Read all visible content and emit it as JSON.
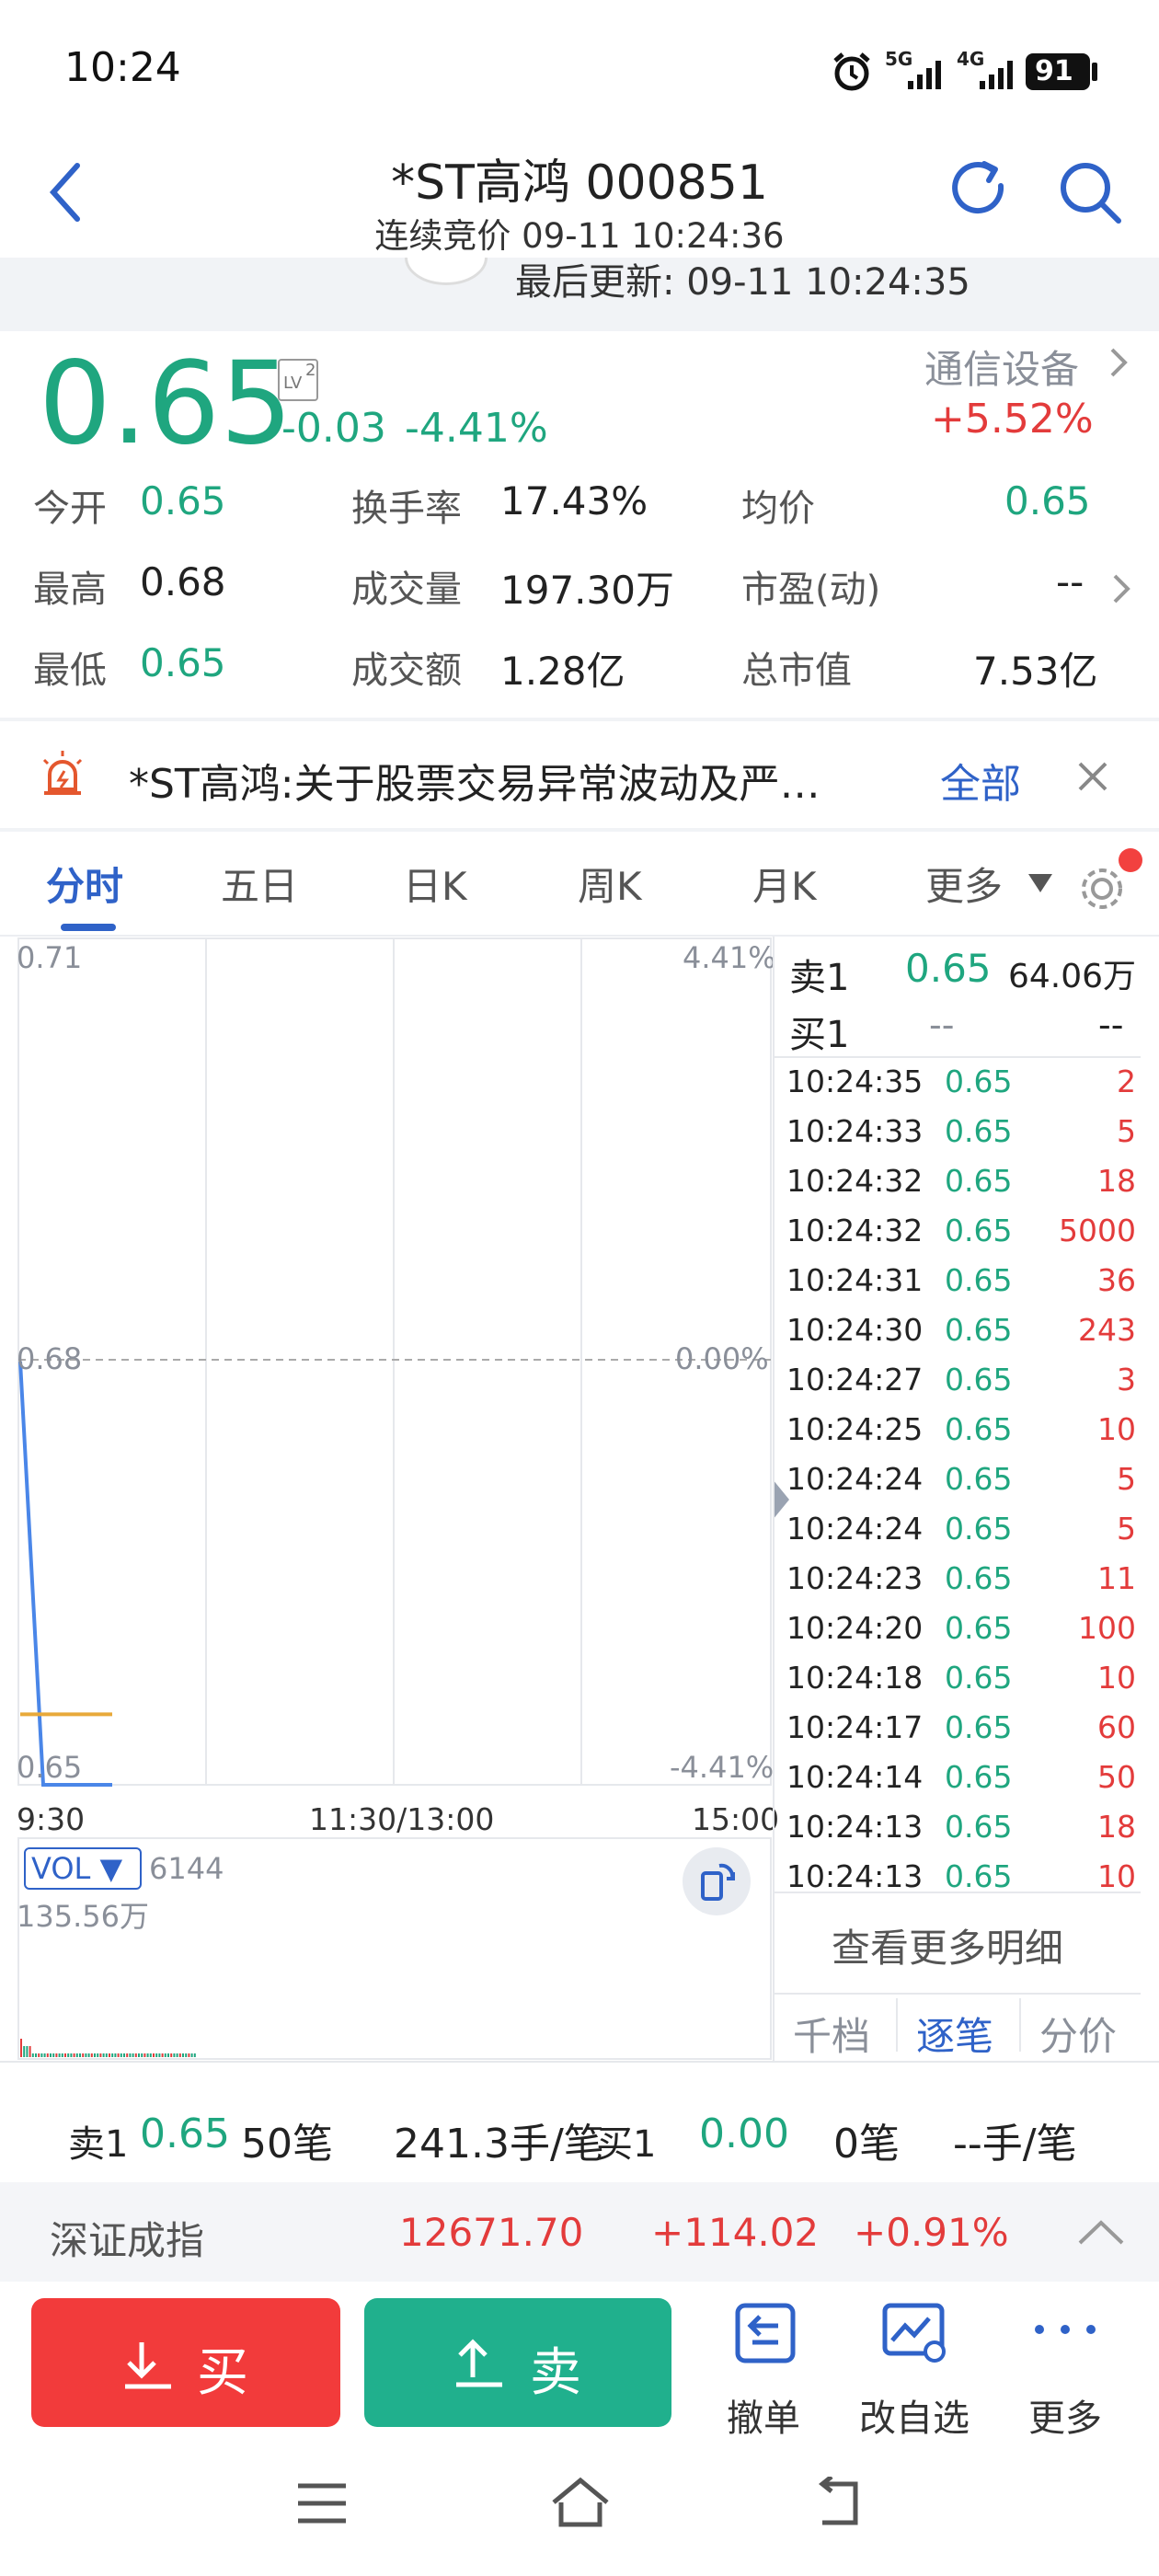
{
  "status_bar": {
    "time": "10:24",
    "net1": "5G",
    "net2": "4G",
    "battery": "91"
  },
  "header": {
    "title": "*ST高鸿 000851",
    "subtitle": "连续竞价 09-11 10:24:36"
  },
  "strip": {
    "text": "最后更新: 09-11 10:24:35"
  },
  "quote": {
    "price": "0.65",
    "level_badge": "LV",
    "level_sup": "2",
    "change": "-0.03",
    "change_pct": "-4.41%",
    "sector_name": "通信设备",
    "sector_change": "+5.52%",
    "stats": [
      {
        "label": "今开",
        "value": "0.65"
      },
      {
        "label": "换手率",
        "value": "17.43%"
      },
      {
        "label": "均价",
        "value": "0.65"
      },
      {
        "label": "最高",
        "value": "0.68"
      },
      {
        "label": "成交量",
        "value": "197.30万"
      },
      {
        "label": "市盈(动)",
        "value": "--"
      },
      {
        "label": "最低",
        "value": "0.65"
      },
      {
        "label": "成交额",
        "value": "1.28亿"
      },
      {
        "label": "总市值",
        "value": "7.53亿"
      }
    ]
  },
  "notice": {
    "text": "*ST高鸿:关于股票交易异常波动及严…",
    "all_label": "全部"
  },
  "tabs": [
    "分时",
    "五日",
    "日K",
    "周K",
    "月K",
    "更多"
  ],
  "chart": {
    "y_top": "0.71",
    "y_mid": "0.68",
    "y_bottom": "0.65",
    "pct_top": "4.41%",
    "pct_mid": "0.00%",
    "pct_bottom": "-4.41%",
    "x_start": "9:30",
    "x_mid": "11:30/13:00",
    "x_end": "15:00",
    "vol_label": "VOL ▼",
    "vol_value": "6144",
    "vol_max": "135.56万"
  },
  "chart_data": {
    "type": "line",
    "ylim": [
      0.65,
      0.71
    ],
    "series": [
      {
        "name": "",
        "color": "#4a86e8",
        "values": [
          0.68,
          0.65,
          0.65,
          0.65,
          0.65
        ]
      },
      {
        "name": "",
        "color": "#e8a93a",
        "values": [
          0.655,
          0.655,
          0.655,
          0.655,
          0.655
        ]
      }
    ]
  },
  "order_book": {
    "sell1_label": "卖1",
    "sell1_price": "0.65",
    "sell1_vol": "64.06万",
    "buy1_label": "买1",
    "buy1_price": "--",
    "buy1_vol": "--"
  },
  "ticks": [
    {
      "time": "10:24:35",
      "price": "0.65",
      "vol": "2"
    },
    {
      "time": "10:24:33",
      "price": "0.65",
      "vol": "5"
    },
    {
      "time": "10:24:32",
      "price": "0.65",
      "vol": "18"
    },
    {
      "time": "10:24:32",
      "price": "0.65",
      "vol": "5000"
    },
    {
      "time": "10:24:31",
      "price": "0.65",
      "vol": "36"
    },
    {
      "time": "10:24:30",
      "price": "0.65",
      "vol": "243"
    },
    {
      "time": "10:24:27",
      "price": "0.65",
      "vol": "3"
    },
    {
      "time": "10:24:25",
      "price": "0.65",
      "vol": "10"
    },
    {
      "time": "10:24:24",
      "price": "0.65",
      "vol": "5"
    },
    {
      "time": "10:24:24",
      "price": "0.65",
      "vol": "5"
    },
    {
      "time": "10:24:23",
      "price": "0.65",
      "vol": "11"
    },
    {
      "time": "10:24:20",
      "price": "0.65",
      "vol": "100"
    },
    {
      "time": "10:24:18",
      "price": "0.65",
      "vol": "10"
    },
    {
      "time": "10:24:17",
      "price": "0.65",
      "vol": "60"
    },
    {
      "time": "10:24:14",
      "price": "0.65",
      "vol": "50"
    },
    {
      "time": "10:24:13",
      "price": "0.65",
      "vol": "18"
    },
    {
      "time": "10:24:13",
      "price": "0.65",
      "vol": "10"
    }
  ],
  "detail_more": "查看更多明细",
  "detail_tabs": [
    "千档",
    "逐笔",
    "分价"
  ],
  "queue": {
    "sell_label": "卖1",
    "sell_price": "0.65",
    "sell_count": "50笔",
    "sell_avg": "241.3手/笔",
    "buy_label": "买1",
    "buy_price": "0.00",
    "buy_count": "0笔",
    "buy_avg": "--手/笔"
  },
  "index_bar": {
    "name": "深证成指",
    "value": "12671.70",
    "change": "+114.02",
    "pct": "+0.91%"
  },
  "bottom_actions": {
    "buy": "买",
    "sell": "卖",
    "cancel": "撤单",
    "edit_watch": "改自选",
    "more": "更多"
  }
}
